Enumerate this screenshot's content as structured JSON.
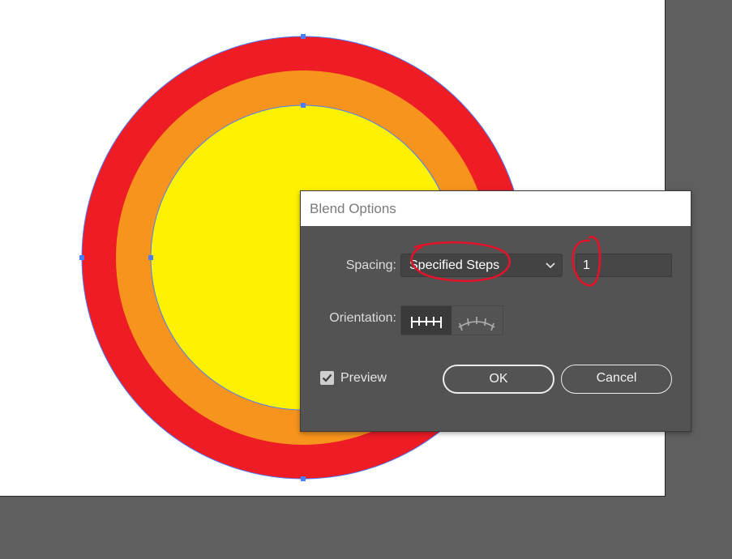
{
  "colors": {
    "outer_circle": "#ee1c25",
    "middle_circle": "#f7941d",
    "inner_circle": "#fff200",
    "selection": "#4a7dff",
    "annotation": "#e0142a"
  },
  "dialog": {
    "title": "Blend Options",
    "spacing_label": "Spacing:",
    "spacing_value": "Specified Steps",
    "steps_value": "1",
    "orientation_label": "Orientation:",
    "orientation_options": [
      "align-to-page-icon",
      "align-to-path-icon"
    ],
    "orientation_selected": "align-to-page-icon",
    "preview_label": "Preview",
    "preview_checked": true,
    "ok_label": "OK",
    "cancel_label": "Cancel"
  }
}
